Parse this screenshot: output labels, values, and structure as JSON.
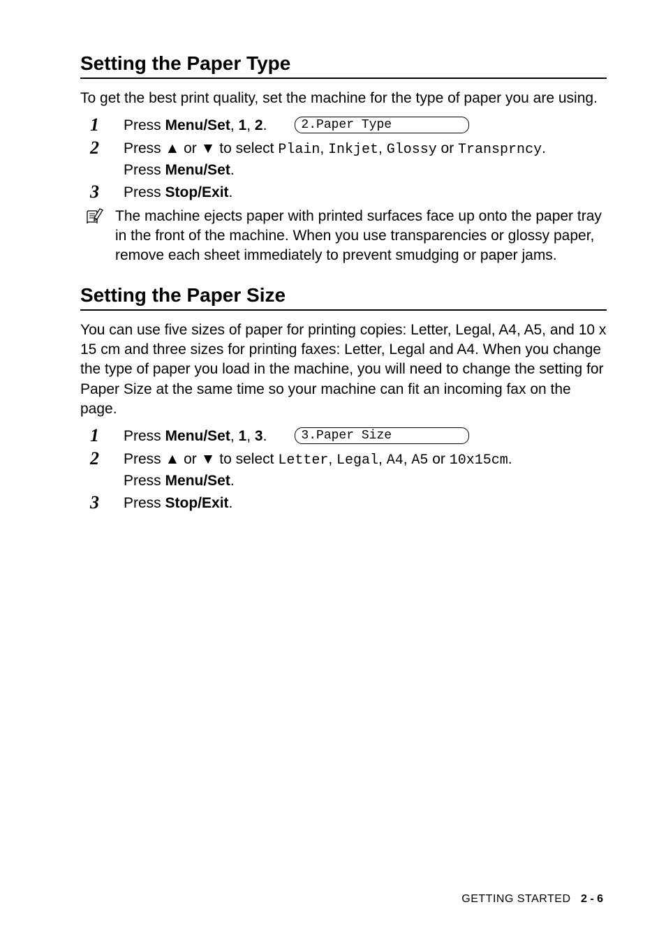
{
  "section1": {
    "title": "Setting the Paper Type",
    "intro": "To get the best print quality, set the machine for the type of paper you are using.",
    "step1_pre": "Press ",
    "step1_bold": "Menu/Set",
    "step1_post": ", ",
    "step1_b1": "1",
    "step1_mid": ", ",
    "step1_b2": "2",
    "step1_end": ".",
    "lcd": "2.Paper Type",
    "step2_pre": "Press ▲ or ▼ to select ",
    "step2_opt1": "Plain",
    "step2_c1": ", ",
    "step2_opt2": "Inkjet",
    "step2_c2": ", ",
    "step2_opt3": "Glossy",
    "step2_or": " or ",
    "step2_opt4": "Transprncy",
    "step2_end": ".",
    "step2_line2_pre": "Press ",
    "step2_line2_bold": "Menu/Set",
    "step2_line2_end": ".",
    "step3_pre": "Press ",
    "step3_bold": "Stop/Exit",
    "step3_end": ".",
    "note": "The machine ejects paper with printed surfaces face up onto the paper tray in the front of the machine. When you use transparencies or glossy paper, remove each sheet immediately to prevent smudging or paper jams."
  },
  "section2": {
    "title": "Setting the Paper Size",
    "intro": "You can use five sizes of paper for printing copies: Letter, Legal, A4, A5, and 10 x 15 cm and three sizes for printing faxes: Letter, Legal and A4. When you change the type of paper you load in the machine, you will need to change the setting for Paper Size at the same time so your machine can fit an incoming fax on the page.",
    "step1_pre": "Press ",
    "step1_bold": "Menu/Set",
    "step1_post": ", ",
    "step1_b1": "1",
    "step1_mid": ", ",
    "step1_b2": "3",
    "step1_end": ".",
    "lcd": "3.Paper Size",
    "step2_pre": "Press ▲ or ▼ to select ",
    "step2_opt1": "Letter",
    "step2_c1": ", ",
    "step2_opt2": "Legal",
    "step2_c2": ", ",
    "step2_opt3": "A4",
    "step2_c3": ", ",
    "step2_opt4": "A5",
    "step2_or": " or ",
    "step2_opt5": "10x15cm",
    "step2_end": ".",
    "step2_line2_pre": "Press ",
    "step2_line2_bold": "Menu/Set",
    "step2_line2_end": ".",
    "step3_pre": "Press ",
    "step3_bold": "Stop/Exit",
    "step3_end": "."
  },
  "footer": {
    "label": "GETTING STARTED",
    "page": "2 - 6"
  }
}
